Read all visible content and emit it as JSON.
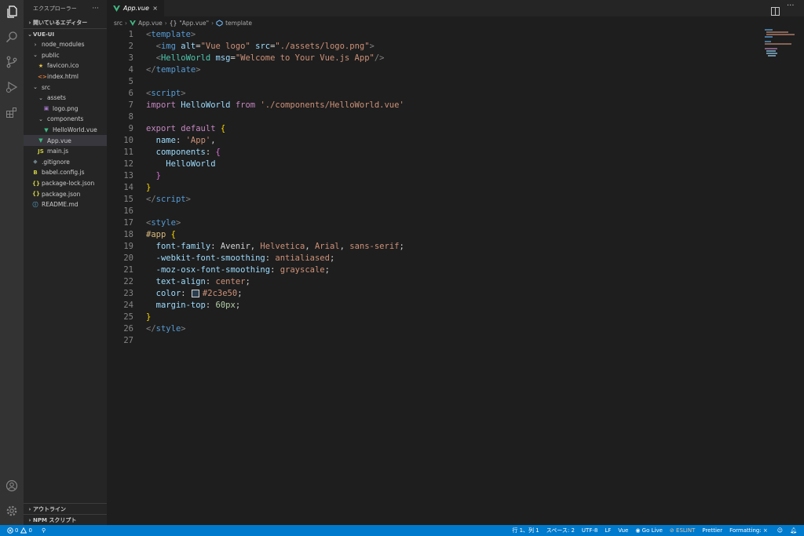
{
  "colors": {
    "accent": "#007acc",
    "background": "#1e1e1e",
    "sidebar": "#252526",
    "activity_bar": "#333333",
    "swatch": "#2c3e50"
  },
  "sidebar": {
    "title": "エクスプローラー",
    "more": "···",
    "open_editors": "開いているエディター",
    "project": "VUE-UI",
    "items": [
      {
        "label": "node_modules",
        "icon": "chevron-right",
        "depth": 1
      },
      {
        "label": "public",
        "icon": "chevron-down",
        "depth": 1
      },
      {
        "label": "favicon.ico",
        "icon": "star",
        "depth": 2
      },
      {
        "label": "index.html",
        "icon": "html",
        "depth": 2
      },
      {
        "label": "src",
        "icon": "chevron-down",
        "depth": 1
      },
      {
        "label": "assets",
        "icon": "chevron-down",
        "depth": 2
      },
      {
        "label": "logo.png",
        "icon": "image",
        "depth": 3
      },
      {
        "label": "components",
        "icon": "chevron-down",
        "depth": 2
      },
      {
        "label": "HelloWorld.vue",
        "icon": "vue",
        "depth": 3
      },
      {
        "label": "App.vue",
        "icon": "vue",
        "depth": 2
      },
      {
        "label": "main.js",
        "icon": "js",
        "depth": 2
      },
      {
        "label": ".gitignore",
        "icon": "git",
        "depth": 1
      },
      {
        "label": "babel.config.js",
        "icon": "babel",
        "depth": 1
      },
      {
        "label": "package-lock.json",
        "icon": "json",
        "depth": 1
      },
      {
        "label": "package.json",
        "icon": "json",
        "depth": 1
      },
      {
        "label": "README.md",
        "icon": "info",
        "depth": 1
      }
    ],
    "outline": "アウトライン",
    "npm": "NPM スクリプト"
  },
  "tab": {
    "label": "App.vue",
    "close": "×"
  },
  "breadcrumb": {
    "p1": "src",
    "p2": "App.vue",
    "p3": "\"App.vue\"",
    "p4": "template"
  },
  "code": [
    [
      [
        "t-ang",
        "<"
      ],
      [
        "t-tag",
        "template"
      ],
      [
        "t-ang",
        ">"
      ]
    ],
    [
      [
        "t-def",
        "  "
      ],
      [
        "t-ang",
        "<"
      ],
      [
        "t-tag",
        "img"
      ],
      [
        "t-def",
        " "
      ],
      [
        "t-attr",
        "alt"
      ],
      [
        "t-def",
        "="
      ],
      [
        "t-str",
        "\"Vue logo\""
      ],
      [
        "t-def",
        " "
      ],
      [
        "t-attr",
        "src"
      ],
      [
        "t-def",
        "="
      ],
      [
        "t-str",
        "\"./assets/logo.png\""
      ],
      [
        "t-ang",
        ">"
      ]
    ],
    [
      [
        "t-def",
        "  "
      ],
      [
        "t-ang",
        "<"
      ],
      [
        "t-cls",
        "HelloWorld"
      ],
      [
        "t-def",
        " "
      ],
      [
        "t-attr",
        "msg"
      ],
      [
        "t-def",
        "="
      ],
      [
        "t-str",
        "\"Welcome to Your Vue.js App\""
      ],
      [
        "t-ang",
        "/>"
      ]
    ],
    [
      [
        "t-ang",
        "</"
      ],
      [
        "t-tag",
        "template"
      ],
      [
        "t-ang",
        ">"
      ]
    ],
    [],
    [
      [
        "t-ang",
        "<"
      ],
      [
        "t-tag",
        "script"
      ],
      [
        "t-ang",
        ">"
      ]
    ],
    [
      [
        "t-kw",
        "import"
      ],
      [
        "t-def",
        " "
      ],
      [
        "t-attr",
        "HelloWorld"
      ],
      [
        "t-def",
        " "
      ],
      [
        "t-kw",
        "from"
      ],
      [
        "t-def",
        " "
      ],
      [
        "t-str",
        "'./components/HelloWorld.vue'"
      ]
    ],
    [],
    [
      [
        "t-kw",
        "export"
      ],
      [
        "t-def",
        " "
      ],
      [
        "t-kw",
        "default"
      ],
      [
        "t-def",
        " "
      ],
      [
        "t-br1",
        "{"
      ]
    ],
    [
      [
        "t-def",
        "  "
      ],
      [
        "t-prop",
        "name"
      ],
      [
        "t-def",
        ": "
      ],
      [
        "t-str",
        "'App'"
      ],
      [
        "t-def",
        ","
      ]
    ],
    [
      [
        "t-def",
        "  "
      ],
      [
        "t-prop",
        "components"
      ],
      [
        "t-def",
        ": "
      ],
      [
        "t-br2",
        "{"
      ]
    ],
    [
      [
        "t-def",
        "    "
      ],
      [
        "t-attr",
        "HelloWorld"
      ]
    ],
    [
      [
        "t-def",
        "  "
      ],
      [
        "t-br2",
        "}"
      ]
    ],
    [
      [
        "t-br1",
        "}"
      ]
    ],
    [
      [
        "t-ang",
        "</"
      ],
      [
        "t-tag",
        "script"
      ],
      [
        "t-ang",
        ">"
      ]
    ],
    [],
    [
      [
        "t-ang",
        "<"
      ],
      [
        "t-tag",
        "style"
      ],
      [
        "t-ang",
        ">"
      ]
    ],
    [
      [
        "t-sel",
        "#app"
      ],
      [
        "t-def",
        " "
      ],
      [
        "t-br1",
        "{"
      ]
    ],
    [
      [
        "t-def",
        "  "
      ],
      [
        "t-prop",
        "font-family"
      ],
      [
        "t-def",
        ": Avenir, "
      ],
      [
        "t-str",
        "Helvetica"
      ],
      [
        "t-def",
        ", "
      ],
      [
        "t-str",
        "Arial"
      ],
      [
        "t-def",
        ", "
      ],
      [
        "t-str",
        "sans-serif"
      ],
      [
        "t-def",
        ";"
      ]
    ],
    [
      [
        "t-def",
        "  "
      ],
      [
        "t-prop",
        "-webkit-font-smoothing"
      ],
      [
        "t-def",
        ": "
      ],
      [
        "t-str",
        "antialiased"
      ],
      [
        "t-def",
        ";"
      ]
    ],
    [
      [
        "t-def",
        "  "
      ],
      [
        "t-prop",
        "-moz-osx-font-smoothing"
      ],
      [
        "t-def",
        ": "
      ],
      [
        "t-str",
        "grayscale"
      ],
      [
        "t-def",
        ";"
      ]
    ],
    [
      [
        "t-def",
        "  "
      ],
      [
        "t-prop",
        "text-align"
      ],
      [
        "t-def",
        ": "
      ],
      [
        "t-str",
        "center"
      ],
      [
        "t-def",
        ";"
      ]
    ],
    [
      [
        "t-def",
        "  "
      ],
      [
        "t-prop",
        "color"
      ],
      [
        "t-def",
        ": "
      ],
      [
        "swatch",
        ""
      ],
      [
        "t-str",
        "#2c3e50"
      ],
      [
        "t-def",
        ";"
      ]
    ],
    [
      [
        "t-def",
        "  "
      ],
      [
        "t-prop",
        "margin-top"
      ],
      [
        "t-def",
        ": "
      ],
      [
        "t-num",
        "60px"
      ],
      [
        "t-def",
        ";"
      ]
    ],
    [
      [
        "t-br1",
        "}"
      ]
    ],
    [
      [
        "t-ang",
        "</"
      ],
      [
        "t-tag",
        "style"
      ],
      [
        "t-ang",
        ">"
      ]
    ],
    []
  ],
  "status": {
    "errors": "0",
    "warnings": "0",
    "position": "行 1、列 1",
    "spaces": "スペース: 2",
    "encoding": "UTF-8",
    "eol": "LF",
    "language": "Vue",
    "golive": "Go Live",
    "eslint": "ESLINT",
    "prettier": "Prettier",
    "formatting": "Formatting: ×"
  }
}
